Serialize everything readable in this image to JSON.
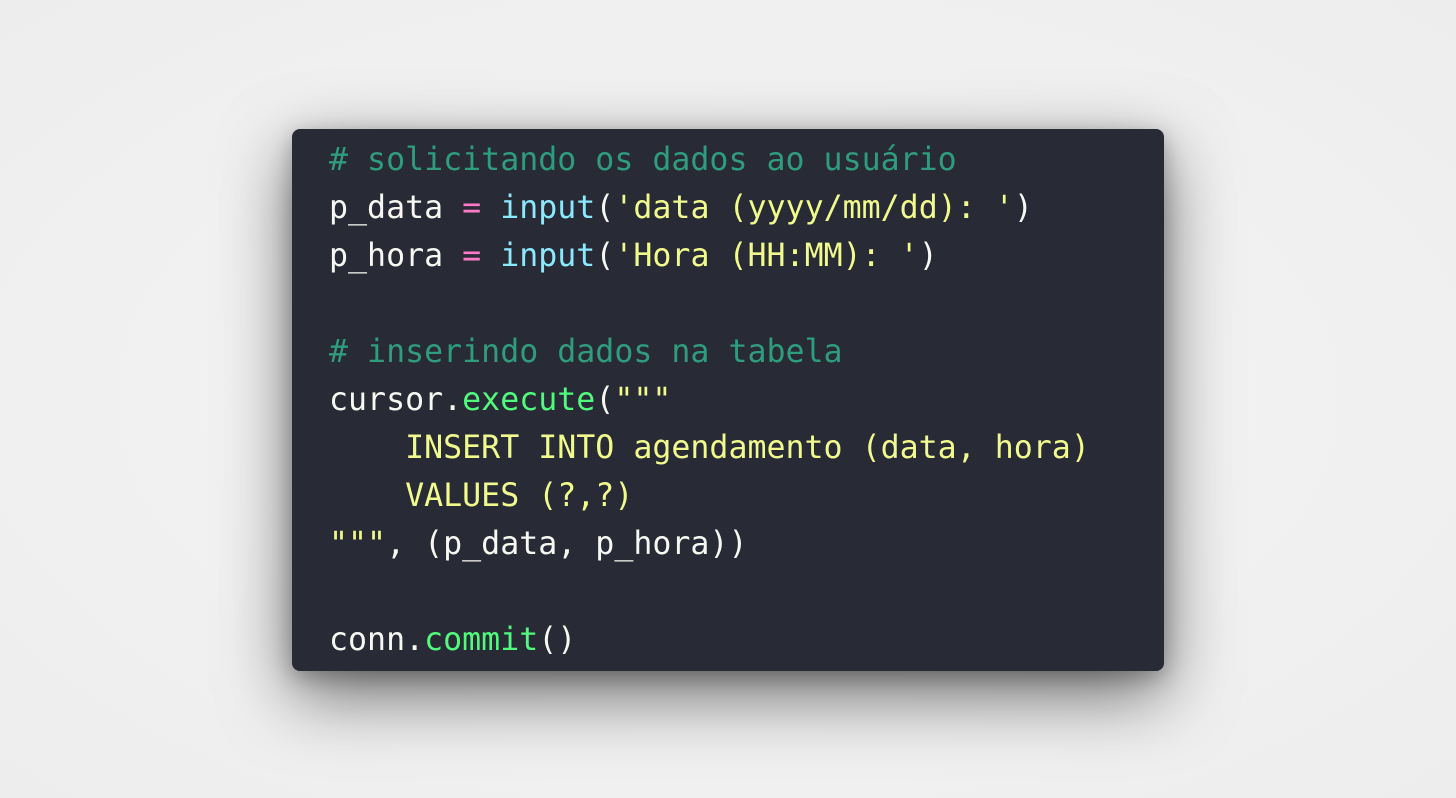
{
  "colors": {
    "background": "#f1f1f1",
    "editor_background": "#282a36",
    "comment": "#2f9c7e",
    "operator": "#ff79c6",
    "builtin": "#8be9fd",
    "function": "#50fa7b",
    "string": "#f1fa8c",
    "plain": "#f8f8f2"
  },
  "code": {
    "language": "python",
    "lines": [
      [
        {
          "t": "comment",
          "v": "# solicitando os dados ao usuário"
        }
      ],
      [
        {
          "t": "plain",
          "v": "p_data "
        },
        {
          "t": "op",
          "v": "="
        },
        {
          "t": "plain",
          "v": " "
        },
        {
          "t": "builtin",
          "v": "input"
        },
        {
          "t": "plain",
          "v": "("
        },
        {
          "t": "str",
          "v": "'data (yyyy/mm/dd): '"
        },
        {
          "t": "plain",
          "v": ")"
        }
      ],
      [
        {
          "t": "plain",
          "v": "p_hora "
        },
        {
          "t": "op",
          "v": "="
        },
        {
          "t": "plain",
          "v": " "
        },
        {
          "t": "builtin",
          "v": "input"
        },
        {
          "t": "plain",
          "v": "("
        },
        {
          "t": "str",
          "v": "'Hora (HH:MM): '"
        },
        {
          "t": "plain",
          "v": ")"
        }
      ],
      [],
      [
        {
          "t": "comment",
          "v": "# inserindo dados na tabela"
        }
      ],
      [
        {
          "t": "plain",
          "v": "cursor."
        },
        {
          "t": "func",
          "v": "execute"
        },
        {
          "t": "plain",
          "v": "("
        },
        {
          "t": "str",
          "v": "\"\"\""
        }
      ],
      [
        {
          "t": "str",
          "v": "    INSERT INTO agendamento (data, hora)"
        }
      ],
      [
        {
          "t": "str",
          "v": "    VALUES (?,?)"
        }
      ],
      [
        {
          "t": "str",
          "v": "\"\"\""
        },
        {
          "t": "plain",
          "v": ", (p_data, p_hora))"
        }
      ],
      [],
      [
        {
          "t": "plain",
          "v": "conn."
        },
        {
          "t": "func",
          "v": "commit"
        },
        {
          "t": "plain",
          "v": "()"
        }
      ]
    ]
  }
}
